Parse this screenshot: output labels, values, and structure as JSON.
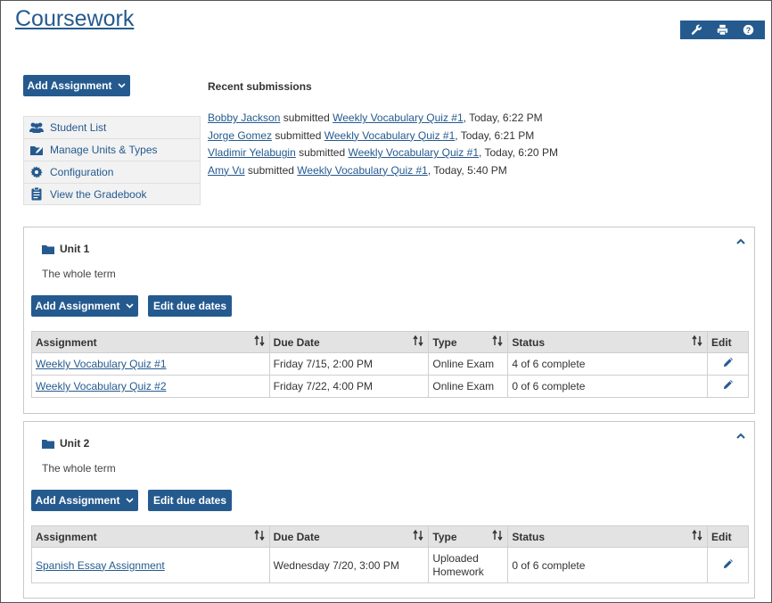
{
  "page": {
    "title": "Coursework"
  },
  "toolbar": {
    "icons": [
      "wrench-icon",
      "print-icon",
      "help-icon"
    ]
  },
  "main_add_button": {
    "label": "Add Assignment"
  },
  "sidebar": {
    "items": [
      {
        "label": "Student List",
        "icon": "users-icon"
      },
      {
        "label": "Manage Units & Types",
        "icon": "folder-edit-icon"
      },
      {
        "label": "Configuration",
        "icon": "gear-icon"
      },
      {
        "label": "View the Gradebook",
        "icon": "clipboard-icon"
      }
    ]
  },
  "recent": {
    "heading": "Recent submissions",
    "verb": "submitted",
    "items": [
      {
        "student": "Bobby Jackson",
        "assignment": "Weekly Vocabulary Quiz #1",
        "time": ", Today, 6:22 PM"
      },
      {
        "student": "Jorge Gomez",
        "assignment": "Weekly Vocabulary Quiz #1",
        "time": ", Today, 6:21 PM"
      },
      {
        "student": "Vladimir Yelabugin",
        "assignment": "Weekly Vocabulary Quiz #1",
        "time": ", Today, 6:20 PM"
      },
      {
        "student": "Amy Vu",
        "assignment": "Weekly Vocabulary Quiz #1",
        "time": ", Today, 5:40 PM"
      }
    ]
  },
  "table_headers": {
    "assignment": "Assignment",
    "due": "Due Date",
    "type": "Type",
    "status": "Status",
    "edit": "Edit"
  },
  "units": [
    {
      "name": "Unit 1",
      "description": "The whole term",
      "add_label": "Add Assignment",
      "due_label": "Edit due dates",
      "rows": [
        {
          "assignment": "Weekly Vocabulary Quiz #1",
          "due": "Friday 7/15, 2:00 PM",
          "type": "Online Exam",
          "status": "4 of 6 complete"
        },
        {
          "assignment": "Weekly Vocabulary Quiz #2",
          "due": "Friday 7/22, 4:00 PM",
          "type": "Online Exam",
          "status": "0 of 6 complete"
        }
      ]
    },
    {
      "name": "Unit 2",
      "description": "The whole term",
      "add_label": "Add Assignment",
      "due_label": "Edit due dates",
      "rows": [
        {
          "assignment": "Spanish Essay Assignment",
          "due": "Wednesday 7/20, 3:00 PM",
          "type": "Uploaded Homework",
          "status": "0 of 6 complete"
        }
      ]
    }
  ],
  "colors": {
    "accent": "#255a8f",
    "header_bg": "#e3e3e3",
    "sidebar_bg": "#f2f2f2"
  }
}
